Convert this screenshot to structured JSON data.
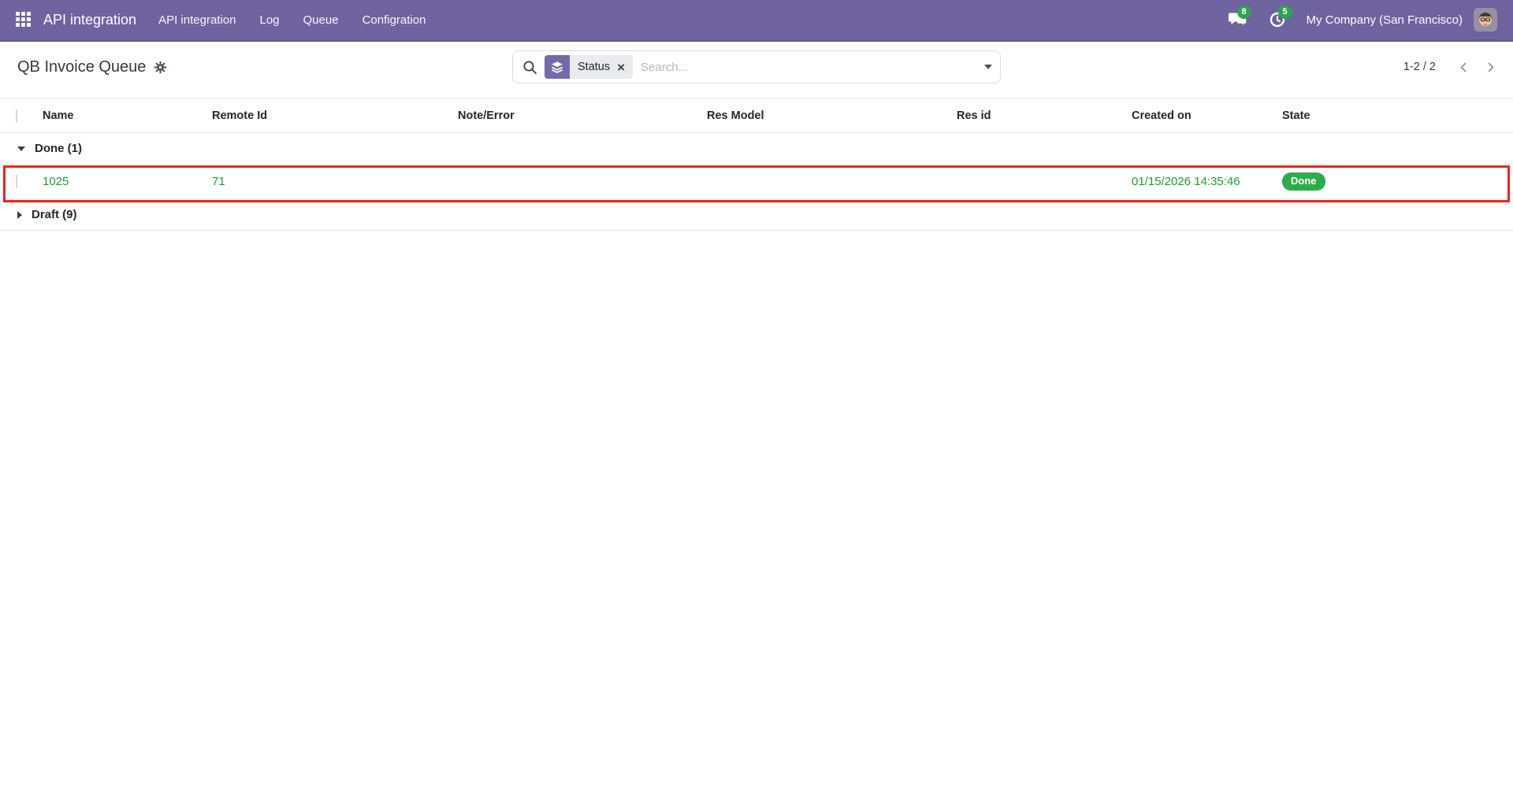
{
  "navbar": {
    "brand": "API integration",
    "menus": [
      {
        "label": "API integration"
      },
      {
        "label": "Log"
      },
      {
        "label": "Queue"
      },
      {
        "label": "Configration"
      }
    ],
    "messages_badge": "8",
    "activities_badge": "5",
    "company": "My Company (San Francisco)"
  },
  "control_panel": {
    "title": "QB Invoice Queue",
    "search": {
      "facet_label": "Status",
      "facet_close": "×",
      "placeholder": "Search..."
    },
    "pager": {
      "text": "1-2 / 2"
    }
  },
  "table": {
    "columns": [
      "Name",
      "Remote Id",
      "Note/Error",
      "Res Model",
      "Res id",
      "Created on",
      "State"
    ],
    "groups": [
      {
        "label": "Done (1)",
        "expanded": true
      },
      {
        "label": "Draft (9)",
        "expanded": false
      }
    ],
    "rows": [
      {
        "name": "1025",
        "remote_id": "71",
        "note_error": "",
        "res_model": "",
        "res_id": "",
        "created_on": "01/15/2026 14:35:46",
        "state": "Done"
      }
    ]
  },
  "icons": {
    "apps": "grid-3x3",
    "messages": "chat-bubbles",
    "activities": "clock",
    "breadcrumb_action": "gear",
    "search": "magnifier",
    "facet": "layers-group-by",
    "pager_prev": "chevron-left",
    "pager_next": "chevron-right"
  },
  "colors": {
    "navbar_bg": "#6e639e",
    "facet_icon_bg": "#7569a8",
    "badge_green": "#2ea44f",
    "state_pill_green": "#2bad4a",
    "text_green": "#18a034",
    "annotation_red": "#e8261d"
  }
}
